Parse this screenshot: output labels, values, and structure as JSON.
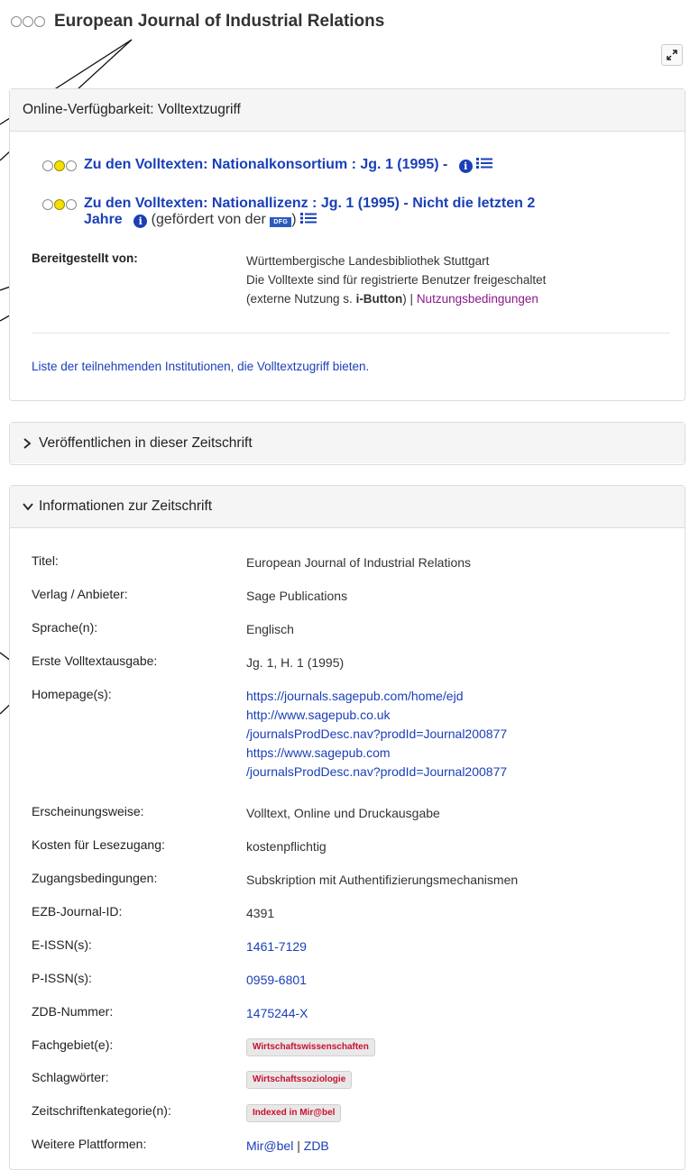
{
  "header": {
    "title": "European Journal of Industrial Relations",
    "expand_icon": "expand-arrows-icon"
  },
  "access": {
    "heading": "Online-Verfügbarkeit: Volltextzugriff",
    "entries": [
      {
        "link": "Zu den Volltexten: Nationalkonsortium : Jg. 1 (1995) -"
      },
      {
        "link_line1": "Zu den Volltexten: Nationallizenz : Jg. 1 (1995) - Nicht die letzten 2",
        "link_line2": "Jahre",
        "funded_prefix": "(gefördert von der",
        "funded_suffix": ")",
        "dfg_logo": "DFG"
      }
    ],
    "provider_label": "Bereitgestellt von:",
    "provider_line1": "Württembergische Landesbibliothek Stuttgart",
    "provider_line2": "Die Volltexte sind für registrierte Benutzer freigeschaltet",
    "provider_line3_prefix": "(externe Nutzung s. ",
    "provider_line3_bold": "i-Button",
    "provider_line3_sep": ") | ",
    "terms_link": "Nutzungsbedingungen",
    "institutions_link": "Liste der teilnehmenden Institutionen, die Volltextzugriff bieten."
  },
  "publish": {
    "heading": "Veröffentlichen in dieser Zeitschrift"
  },
  "info": {
    "heading": "Informationen zur Zeitschrift",
    "rows": [
      {
        "label": "Titel:",
        "value": "European Journal of Industrial Relations"
      },
      {
        "label": "Verlag / Anbieter:",
        "value": "Sage Publications"
      },
      {
        "label": "Sprache(n):",
        "value": "Englisch"
      },
      {
        "label": "Erste Volltextausgabe:",
        "value": "Jg. 1, H. 1 (1995)"
      },
      {
        "label": "Homepage(s):",
        "links": [
          "https://journals.sagepub.com/home/ejd",
          "http://www.sagepub.co.uk",
          "/journalsProdDesc.nav?prodId=Journal200877",
          "https://www.sagepub.com",
          "/journalsProdDesc.nav?prodId=Journal200877"
        ]
      },
      {
        "label": "Erscheinungsweise:",
        "value": "Volltext, Online und Druckausgabe"
      },
      {
        "label": "Kosten für Lesezugang:",
        "value": "kostenpflichtig"
      },
      {
        "label": "Zugangsbedingungen:",
        "value": "Subskription mit Authentifizierungsmechanismen"
      },
      {
        "label": "EZB-Journal-ID:",
        "value": "4391"
      },
      {
        "label": "E-ISSN(s):",
        "value": "1461-7129"
      },
      {
        "label": "P-ISSN(s):",
        "value": "0959-6801"
      },
      {
        "label": "ZDB-Nummer:",
        "value": "1475244-X"
      },
      {
        "label": "Fachgebiet(e):",
        "badge": "Wirtschaftswissenschaften"
      },
      {
        "label": "Schlagwörter:",
        "badge": "Wirtschaftssoziologie"
      },
      {
        "label": "Zeitschriftenkategorie(n):",
        "badge": "Indexed in Mir@bel"
      },
      {
        "label": "Weitere Plattformen:",
        "link_a": "Mir@bel",
        "sep": " | ",
        "link_b": "ZDB"
      }
    ]
  },
  "colors": {
    "link": "#1a3fb8",
    "terms_link": "#8a1a8a",
    "badge_text": "#c8102e",
    "traffic_yellow": "#f3e000"
  }
}
